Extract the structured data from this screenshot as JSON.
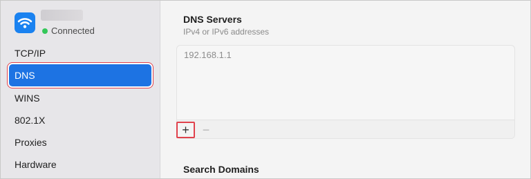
{
  "network": {
    "status": "Connected",
    "status_color": "#34c759",
    "icon": "wifi-icon"
  },
  "sidebar": {
    "items": [
      {
        "label": "TCP/IP",
        "selected": false
      },
      {
        "label": "DNS",
        "selected": true
      },
      {
        "label": "WINS",
        "selected": false
      },
      {
        "label": "802.1X",
        "selected": false
      },
      {
        "label": "Proxies",
        "selected": false
      },
      {
        "label": "Hardware",
        "selected": false
      }
    ]
  },
  "dns": {
    "title": "DNS Servers",
    "subtitle": "IPv4 or IPv6 addresses",
    "servers": [
      "192.168.1.1"
    ],
    "add_label": "+",
    "remove_label": "−"
  },
  "search_domains": {
    "title": "Search Domains"
  },
  "colors": {
    "accent": "#1d73e3",
    "highlight": "#e0414c"
  }
}
